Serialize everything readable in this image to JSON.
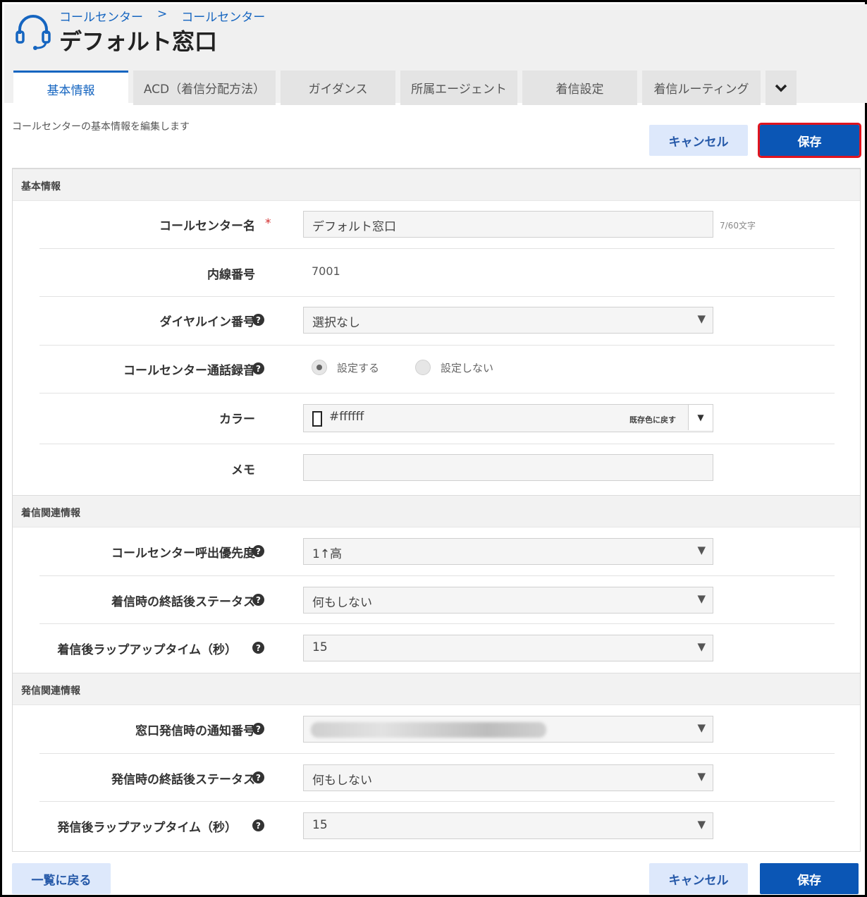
{
  "header": {
    "breadcrumb": [
      "コールセンター",
      "コールセンター"
    ],
    "breadcrumb_sep": ">",
    "title": "デフォルト窓口",
    "icon": "headset-icon"
  },
  "tabs": [
    {
      "label": "基本情報",
      "active": true
    },
    {
      "label": "ACD（着信分配方法）"
    },
    {
      "label": "ガイダンス"
    },
    {
      "label": "所属エージェント"
    },
    {
      "label": "着信設定"
    },
    {
      "label": "着信ルーティング"
    }
  ],
  "tab_more_icon": "chevron-down-icon",
  "description": "コールセンターの基本情報を編集します",
  "buttons": {
    "cancel": "キャンセル",
    "save": "保存",
    "back": "一覧に戻る"
  },
  "sections": {
    "basic": {
      "title": "基本情報",
      "name_label": "コールセンター名",
      "required_mark": "*",
      "name_value": "デフォルト窓口",
      "name_count": "7/60文字",
      "ext_label": "内線番号",
      "ext_value": "7001",
      "dial_label": "ダイヤルイン番号",
      "dial_value": "選択なし",
      "rec_label": "コールセンター通話録音",
      "rec_on": "設定する",
      "rec_off": "設定しない",
      "color_label": "カラー",
      "color_value": "#ffffff",
      "color_reset": "既存色に戻す",
      "memo_label": "メモ",
      "memo_value": ""
    },
    "incoming": {
      "title": "着信関連情報",
      "priority_label": "コールセンター呼出優先度",
      "priority_value": "1↑高",
      "status_label": "着信時の終話後ステータス",
      "status_value": "何もしない",
      "wrap_label": "着信後ラップアップタイム（秒）",
      "wrap_value": "15"
    },
    "outgoing": {
      "title": "発信関連情報",
      "notify_label": "窓口発信時の通知番号",
      "status_label": "発信時の終話後ステータス",
      "status_value": "何もしない",
      "wrap_label": "発信後ラップアップタイム（秒）",
      "wrap_value": "15"
    }
  },
  "help_icon_glyph": "?",
  "dropdown_glyph": "▼",
  "colors": {
    "accent": "#1565c0",
    "save_bg": "#0b56b5",
    "cancel_bg": "#dde8fb",
    "required": "#d32f2f",
    "highlight": "#e0141e"
  }
}
